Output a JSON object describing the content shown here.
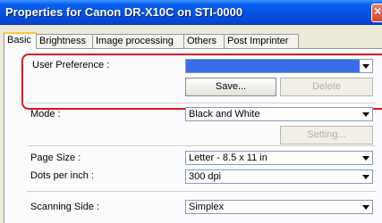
{
  "window": {
    "title": "Properties for Canon DR-X10C on STI-0000",
    "close_glyph": "×"
  },
  "tabs": [
    {
      "label": "Basic",
      "active": true
    },
    {
      "label": "Brightness",
      "active": false
    },
    {
      "label": "Image processing",
      "active": false
    },
    {
      "label": "Others",
      "active": false
    },
    {
      "label": "Post Imprinter",
      "active": false
    }
  ],
  "user_preference": {
    "label": "User Preference :",
    "value": "",
    "save_label": "Save...",
    "delete_label": "Delete"
  },
  "mode": {
    "label": "Mode :",
    "value": "Black and White",
    "setting_label": "Setting..."
  },
  "page_size": {
    "label": "Page Size :",
    "value": "Letter - 8.5 x 11 in"
  },
  "dpi": {
    "label": "Dots per inch :",
    "value": "300 dpi"
  },
  "scanning_side": {
    "label": "Scanning Side :",
    "value": "Simplex"
  },
  "colors": {
    "titlebar": "#0550e0",
    "highlight": "#e0141e",
    "selection": "#3a6ee8"
  }
}
